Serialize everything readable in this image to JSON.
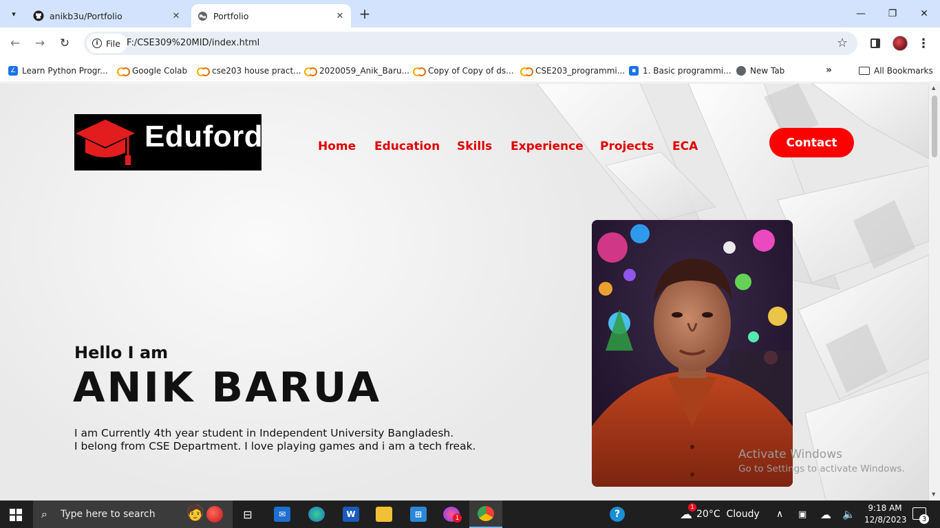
{
  "browser": {
    "tabs": [
      {
        "title": "anikb3u/Portfolio",
        "icon": "github-icon",
        "active": false
      },
      {
        "title": "Portfolio",
        "icon": "globe-icon",
        "active": true
      }
    ],
    "address": {
      "scheme_label": "File",
      "url": "F:/CSE309%20MID/index.html"
    },
    "bookmarks": [
      {
        "label": "Learn Python Progr...",
        "icon": "learn-icon"
      },
      {
        "label": "Google Colab",
        "icon": "colab-icon"
      },
      {
        "label": "cse203 house pract...",
        "icon": "colab-icon"
      },
      {
        "label": "2020059_Anik_Baru...",
        "icon": "colab-icon"
      },
      {
        "label": "Copy of Copy of ds...",
        "icon": "colab-icon"
      },
      {
        "label": "CSE203_programmi...",
        "icon": "colab-icon"
      },
      {
        "label": "1. Basic programmi...",
        "icon": "classroom-icon"
      },
      {
        "label": "New Tab",
        "icon": "globe-icon"
      }
    ],
    "all_bookmarks_label": "All Bookmarks"
  },
  "page": {
    "logo_text": "Eduford",
    "nav": [
      "Home",
      "Education",
      "Skills",
      "Experience",
      "Projects",
      "ECA"
    ],
    "contact_label": "Contact",
    "greeting": "Hello I am",
    "name": "ANIK BARUA",
    "bio_line1": "I am Currently 4th year student in Independent University Bangladesh.",
    "bio_line2": "I belong from CSE Department. I love playing games and i am a tech freak.",
    "accent_color": "#ff0000",
    "nav_color": "#e00000"
  },
  "watermark": {
    "line1": "Activate Windows",
    "line2": "Go to Settings to activate Windows."
  },
  "taskbar": {
    "search_placeholder": "Type here to search",
    "weather": "20°C  Cloudy",
    "weather_badge": "1",
    "time": "9:18 AM",
    "date": "12/8/2023",
    "notification_count": "3",
    "messenger_badge": "1"
  }
}
